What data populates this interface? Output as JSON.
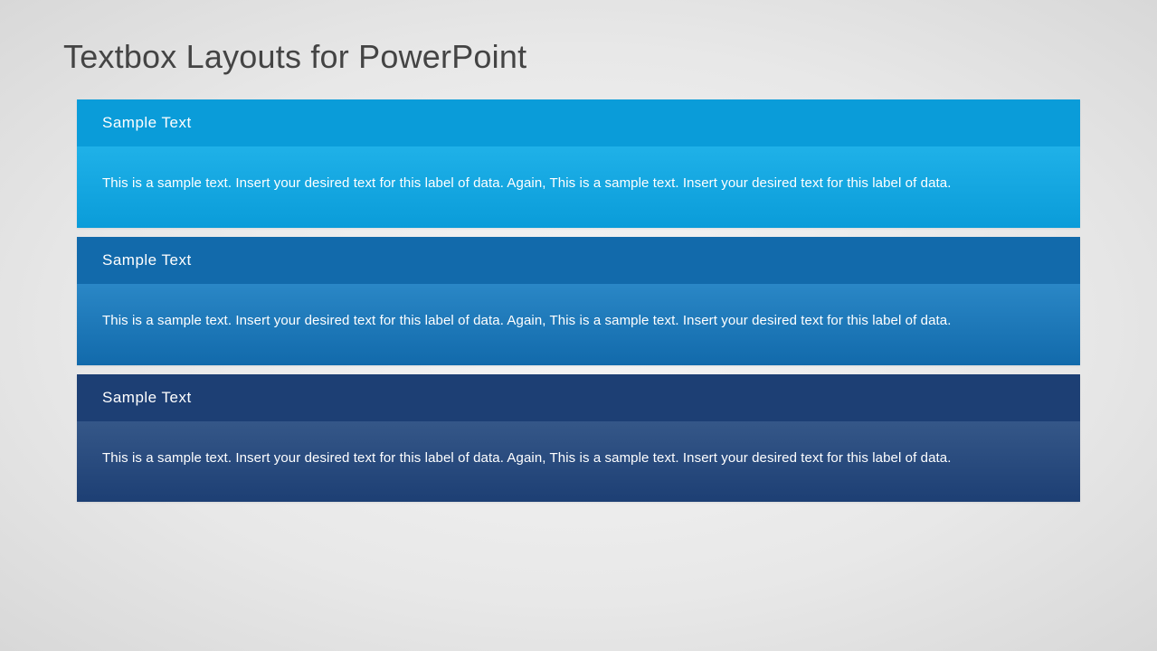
{
  "title": "Textbox Layouts for PowerPoint",
  "cards": [
    {
      "heading": "Sample Text",
      "body": "This is a sample text. Insert your desired text for this label of data. Again, This is a sample text. Insert your desired text for this label of data."
    },
    {
      "heading": "Sample Text",
      "body": "This is a sample text. Insert your desired text for this label of data. Again, This is a sample text. Insert your desired text for this label of data."
    },
    {
      "heading": "Sample Text",
      "body": "This is a sample text. Insert your desired text for this label of data. Again, This is a sample text. Insert your desired text for this label of data."
    }
  ]
}
